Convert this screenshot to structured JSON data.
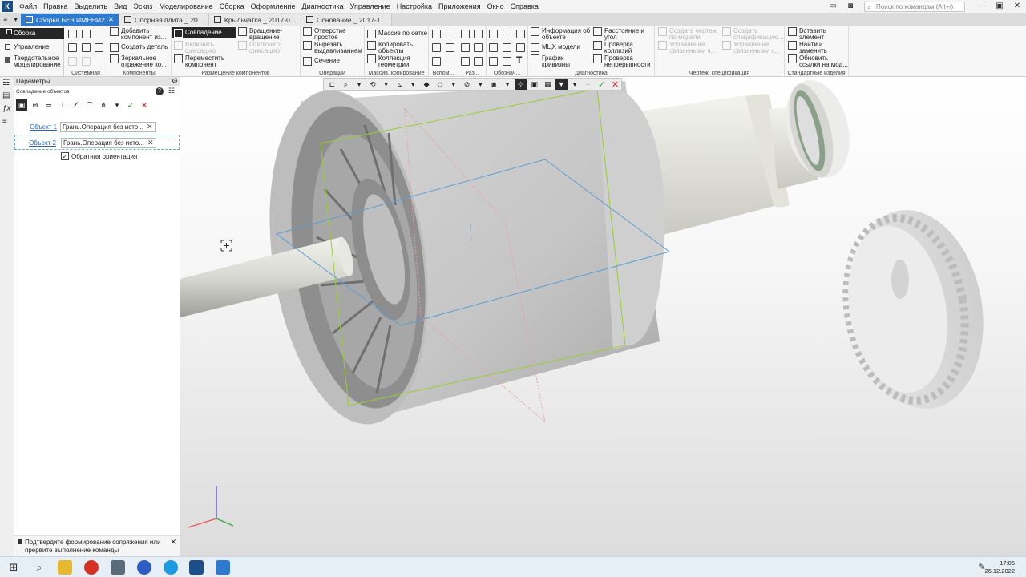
{
  "menu": {
    "app_icon": "К",
    "items": [
      "Файл",
      "Правка",
      "Выделить",
      "Вид",
      "Эскиз",
      "Моделирование",
      "Сборка",
      "Оформление",
      "Диагностика",
      "Управление",
      "Настройка",
      "Приложения",
      "Окно",
      "Справка"
    ],
    "search_placeholder": "Поиск по командам (Alt+/)",
    "window_controls": [
      "—",
      "▣",
      "✕"
    ]
  },
  "tabs": [
    {
      "label": "Сборка БЕЗ ИМЕНИ2",
      "active": true
    },
    {
      "label": "Опорная плита _ 20...",
      "active": false
    },
    {
      "label": "Крыльчатка _ 2017-0...",
      "active": false
    },
    {
      "label": "Основание _ 2017-1...",
      "active": false
    }
  ],
  "mode_panel": {
    "items": [
      {
        "label": "Сборка",
        "active": true
      },
      {
        "label": "Управление",
        "active": false
      },
      {
        "label": "Твердотельное моделирование",
        "active": false
      }
    ]
  },
  "ribbon": {
    "sections": [
      {
        "key": "system",
        "label": "Системная"
      },
      {
        "key": "components",
        "label": "Компоненты"
      },
      {
        "key": "placement",
        "label": "Размещение компонентов"
      },
      {
        "key": "operations",
        "label": "Операции"
      },
      {
        "key": "array",
        "label": "Массив, копирование"
      },
      {
        "key": "aux",
        "label": "Вспом..."
      },
      {
        "key": "ras",
        "label": "Раз..."
      },
      {
        "key": "oboz",
        "label": "Обознач..."
      },
      {
        "key": "diag",
        "label": "Диагностика"
      },
      {
        "key": "drawing",
        "label": "Чертеж, спецификация"
      },
      {
        "key": "std",
        "label": "Стандартные изделия"
      }
    ],
    "buttons": {
      "add_component": "Добавить компонент из...",
      "create_part": "Создать деталь",
      "mirror": "Зеркальное отражение ко...",
      "coincidence": "Совпадение",
      "rotation": "Вращение-вращение",
      "enable_fix": "Включить фиксацию",
      "disable_fix": "Отключить фиксацию",
      "move_component": "Переместить компонент",
      "hole": "Отверстие простое",
      "cut_extrude": "Вырезать выдавливанием",
      "section": "Сечение",
      "grid_array": "Массив по сетке",
      "copy_objects": "Копировать объекты",
      "geometry_collection": "Коллекция геометрии",
      "object_info": "Информация об объекте",
      "mcx_model": "МЦХ модели",
      "curvature_graph": "График кривизны",
      "distance_angle": "Расстояние и угол",
      "collision_check": "Проверка коллизий",
      "continuity_check": "Проверка непрерывности",
      "create_drawing": "Создать чертеж по модели",
      "create_spec": "Создать спецификацию...",
      "manage_linked_1": "Управление связанными ч...",
      "manage_linked_2": "Управление связанными с...",
      "insert_element": "Вставить элемент",
      "find_replace": "Найти и заменить",
      "update_links": "Обновить ссылки на мод..."
    }
  },
  "panel": {
    "title": "Параметры",
    "operation": "Совпадение объектов",
    "help": "?",
    "objects": [
      {
        "link": "Объект 1",
        "value": "Грань.Операция без исто..."
      },
      {
        "link": "Объект 2",
        "value": "Грань.Операция без исто..."
      }
    ],
    "reverse_orientation": {
      "label": "Обратная ориентация",
      "checked": true
    },
    "hint": "Подтвердите формирование сопряжения или прервите выполнение команды"
  },
  "viewport_toolbar": {
    "icons": [
      "sketch-icon",
      "zoom-icon",
      "dropdown-icon",
      "orient-icon",
      "dropdown-icon",
      "axes-icon",
      "dropdown-icon",
      "shaded-cube-icon",
      "wire-cube-icon",
      "dropdown-icon",
      "hide-icon",
      "dropdown-icon",
      "section-view-icon",
      "dropdown-icon",
      "perspective-icon",
      "filter-select-icon",
      "snap-icon",
      "filter-icon",
      "dropdown-icon",
      "pin-icon",
      "apply-icon",
      "cancel-icon"
    ]
  },
  "taskbar": {
    "time": "17:05",
    "date": "26.12.2022"
  },
  "colors": {
    "accent_blue": "#2d7bd1",
    "mode_active": "#262626",
    "ok_green": "#2b9a3c",
    "cancel_red": "#d92f2f",
    "link_blue": "#2463c7"
  }
}
